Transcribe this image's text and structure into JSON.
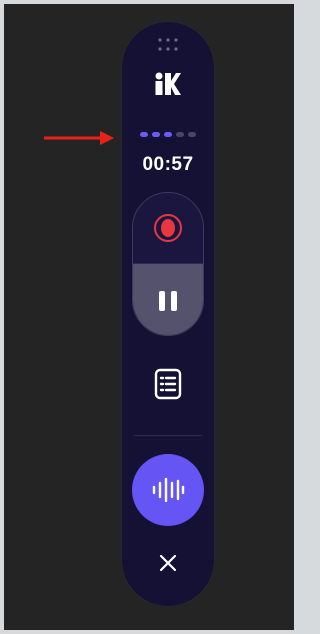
{
  "colors": {
    "background": "#242424",
    "toolbar": "#141134",
    "accent": "#6655f5",
    "record": "#e7383f",
    "annotation_arrow": "#e8211b"
  },
  "annotation": {
    "icon": "arrow-right-icon"
  },
  "toolbar": {
    "drag_handle_icon": "drag-handle-icon",
    "logo_icon": "k-logo-icon",
    "progress": {
      "total": 5,
      "active": 3
    },
    "timer": "00:57",
    "record_icon": "record-icon",
    "pause_icon": "pause-icon",
    "notes_icon": "notes-icon",
    "voice_icon": "voice-waveform-icon",
    "close_icon": "close-icon"
  }
}
